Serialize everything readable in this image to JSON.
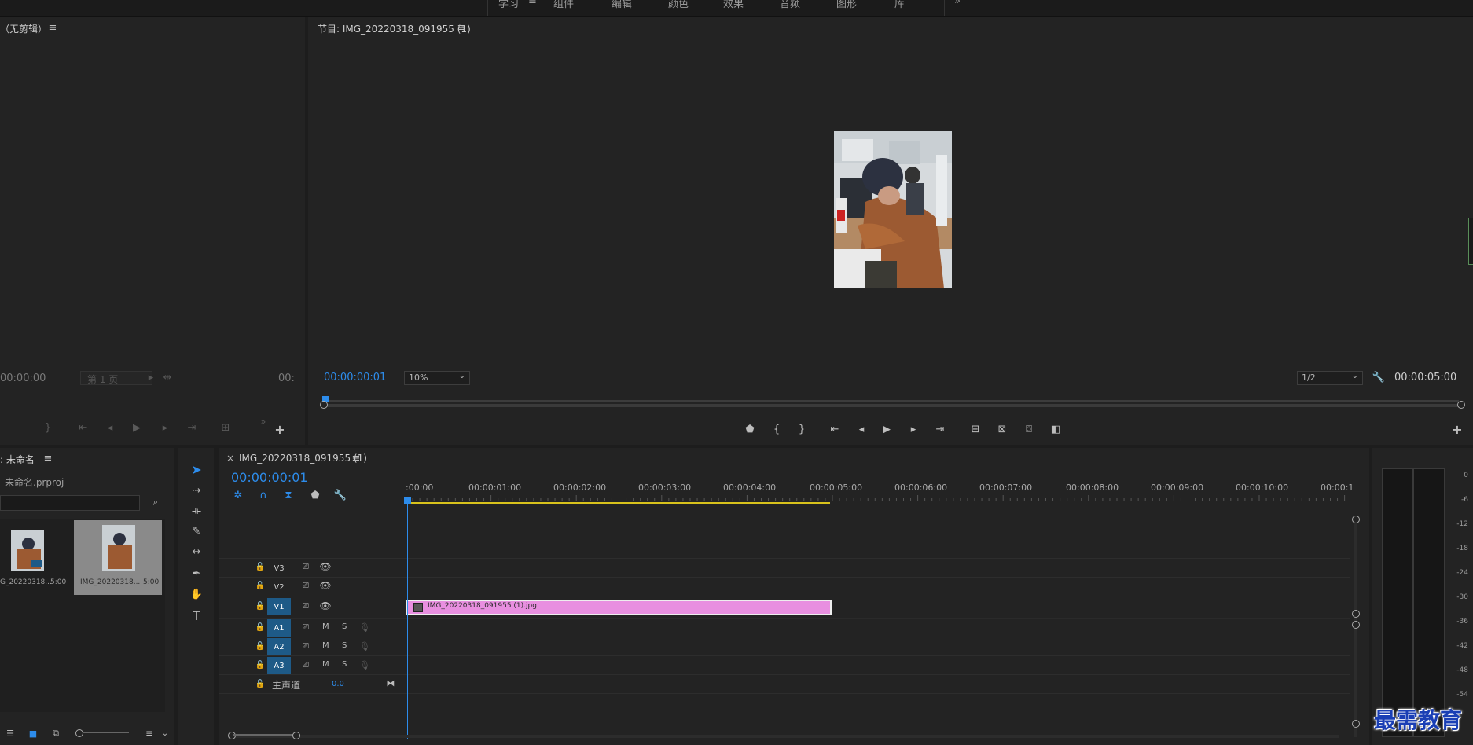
{
  "workspace": {
    "tabs": [
      "学习",
      "组件",
      "编辑",
      "颜色",
      "效果",
      "音频",
      "图形",
      "库"
    ],
    "menu_icon": "hamburger-icon",
    "more_icon": "double-chevron-right-icon"
  },
  "source_monitor": {
    "title": "（无剪辑）",
    "timecode_left": "00:00:00",
    "page_select": "第 1 页",
    "timecode_right": "00:"
  },
  "program_monitor": {
    "title": "节目: IMG_20220318_091955 (1)",
    "timecode": "00:00:00:01",
    "zoom": "10%",
    "quality": "1/2",
    "duration": "00:00:05:00"
  },
  "project": {
    "title": ": 未命名",
    "file": "未命名.prproj",
    "search_placeholder": "",
    "items": [
      {
        "name": "G_20220318...",
        "duration": "5:00"
      },
      {
        "name": "IMG_20220318...",
        "duration": "5:00"
      }
    ]
  },
  "timeline": {
    "close": "×",
    "tab_title": "IMG_20220318_091955 (1)",
    "timecode": "00:00:00:01",
    "ruler": [
      ":00:00",
      "00:00:01:00",
      "00:00:02:00",
      "00:00:03:00",
      "00:00:04:00",
      "00:00:05:00",
      "00:00:06:00",
      "00:00:07:00",
      "00:00:08:00",
      "00:00:09:00",
      "00:00:10:00",
      "00:00:1"
    ],
    "video_tracks": [
      "V3",
      "V2",
      "V1"
    ],
    "audio_tracks": [
      "A1",
      "A2",
      "A3"
    ],
    "mute": "M",
    "solo": "S",
    "master_label": "主声道",
    "master_value": "0.0",
    "clip_name": "IMG_20220318_091955 (1).jpg",
    "clip_color": "#e88fe0"
  },
  "meters": {
    "scale": [
      "0",
      "-6",
      "-12",
      "-18",
      "-24",
      "-30",
      "-36",
      "-42",
      "-48",
      "-54"
    ]
  },
  "watermark": "最需教育",
  "colors": {
    "accent": "#2d8ceb",
    "track_on": "#1e5a87",
    "work_area": "#d8c21c"
  }
}
